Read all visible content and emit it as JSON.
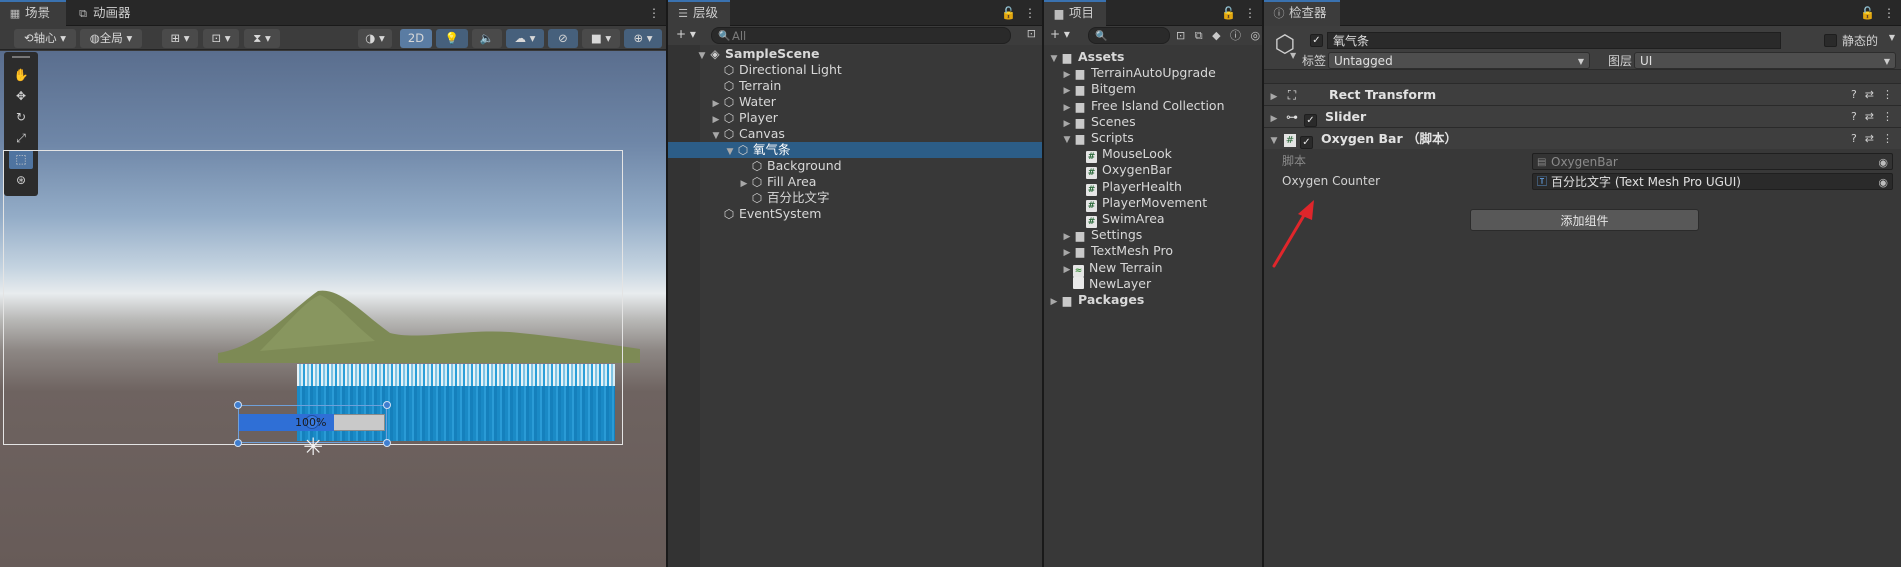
{
  "scene": {
    "tabs": [
      {
        "label": "场景",
        "icon": "grid-icon"
      },
      {
        "label": "动画器",
        "icon": "animator-icon"
      }
    ],
    "more": "⋮",
    "toolbar": {
      "pivot": "轴心",
      "global": "全局",
      "two_d": "2D"
    },
    "slider_text": "100%"
  },
  "hierarchy": {
    "tab": "层级",
    "add": "+ ▾",
    "search_placeholder": "All",
    "items": [
      {
        "label": "SampleScene",
        "depth": 0,
        "arrow": "▼",
        "icon": "unity-scene-icon"
      },
      {
        "label": "Directional Light",
        "depth": 1,
        "arrow": "",
        "icon": "gameobject-icon"
      },
      {
        "label": "Terrain",
        "depth": 1,
        "arrow": "",
        "icon": "gameobject-icon"
      },
      {
        "label": "Water",
        "depth": 1,
        "arrow": "▶",
        "icon": "gameobject-icon"
      },
      {
        "label": "Player",
        "depth": 1,
        "arrow": "▶",
        "icon": "gameobject-icon"
      },
      {
        "label": "Canvas",
        "depth": 1,
        "arrow": "▼",
        "icon": "gameobject-icon"
      },
      {
        "label": "氧气条",
        "depth": 2,
        "arrow": "▼",
        "icon": "gameobject-icon",
        "selected": true
      },
      {
        "label": "Background",
        "depth": 3,
        "arrow": "",
        "icon": "gameobject-icon"
      },
      {
        "label": "Fill Area",
        "depth": 3,
        "arrow": "▶",
        "icon": "gameobject-icon"
      },
      {
        "label": "百分比文字",
        "depth": 3,
        "arrow": "",
        "icon": "gameobject-icon"
      },
      {
        "label": "EventSystem",
        "depth": 1,
        "arrow": "",
        "icon": "gameobject-icon"
      }
    ]
  },
  "project": {
    "tab": "项目",
    "add": "+ ▾",
    "items": [
      {
        "label": "Assets",
        "depth": 0,
        "arrow": "▼",
        "type": "folder",
        "bold": true
      },
      {
        "label": "TerrainAutoUpgrade",
        "depth": 1,
        "arrow": "▶",
        "type": "folder"
      },
      {
        "label": "Bitgem",
        "depth": 1,
        "arrow": "▶",
        "type": "folder"
      },
      {
        "label": "Free Island Collection",
        "depth": 1,
        "arrow": "▶",
        "type": "folder"
      },
      {
        "label": "Scenes",
        "depth": 1,
        "arrow": "▶",
        "type": "folder"
      },
      {
        "label": "Scripts",
        "depth": 1,
        "arrow": "▼",
        "type": "folder"
      },
      {
        "label": "MouseLook",
        "depth": 2,
        "arrow": "",
        "type": "script"
      },
      {
        "label": "OxygenBar",
        "depth": 2,
        "arrow": "",
        "type": "script"
      },
      {
        "label": "PlayerHealth",
        "depth": 2,
        "arrow": "",
        "type": "script"
      },
      {
        "label": "PlayerMovement",
        "depth": 2,
        "arrow": "",
        "type": "script"
      },
      {
        "label": "SwimArea",
        "depth": 2,
        "arrow": "",
        "type": "script"
      },
      {
        "label": "Settings",
        "depth": 1,
        "arrow": "▶",
        "type": "folder"
      },
      {
        "label": "TextMesh Pro",
        "depth": 1,
        "arrow": "▶",
        "type": "folder"
      },
      {
        "label": "New Terrain",
        "depth": 1,
        "arrow": "▶",
        "type": "terrain"
      },
      {
        "label": "NewLayer",
        "depth": 1,
        "arrow": "",
        "type": "file"
      },
      {
        "label": "Packages",
        "depth": 0,
        "arrow": "▶",
        "type": "folder",
        "bold": true
      }
    ]
  },
  "inspector": {
    "tab": "检查器",
    "object_name": "氧气条",
    "static_label": "静态的",
    "tag_label": "标签",
    "tag_value": "Untagged",
    "layer_label": "图层",
    "layer_value": "UI",
    "components": [
      {
        "name": "Rect Transform",
        "has_check": false,
        "icon": "rect-transform-icon"
      },
      {
        "name": "Slider",
        "has_check": true,
        "icon": "slider-icon"
      },
      {
        "name": "Oxygen Bar （脚本）",
        "has_check": true,
        "icon": "script-icon"
      }
    ],
    "script_label": "脚本",
    "script_value": "OxygenBar",
    "oxygen_counter_label": "Oxygen Counter",
    "oxygen_counter_value": "百分比文字 (Text Mesh Pro UGUI)",
    "add_component": "添加组件"
  },
  "colors": {
    "selection": "#2c5d87",
    "accent": "#3a72b0",
    "annotation_arrow": "#e0262b"
  }
}
